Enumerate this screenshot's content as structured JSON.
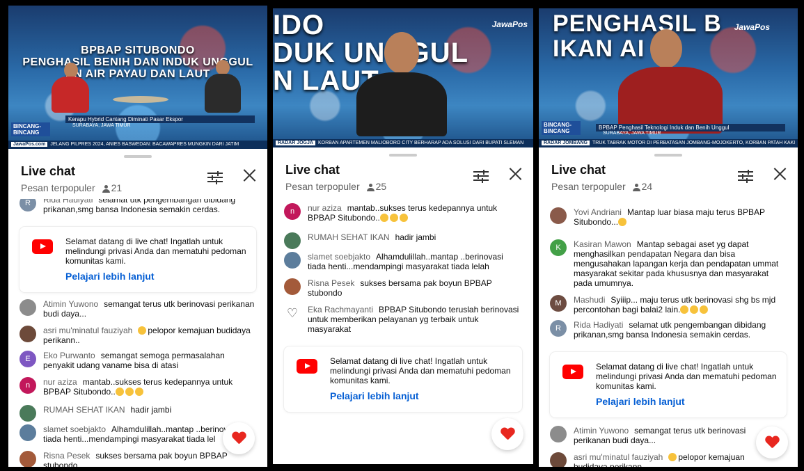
{
  "chat": {
    "title": "Live chat",
    "subtitle": "Pesan terpopuler",
    "welcome_text": "Selamat datang di live chat! Ingatlah untuk melindungi privasi Anda dan mematuhi pedoman komunitas kami.",
    "welcome_link": "Pelajari lebih lanjut"
  },
  "colors": {
    "link": "#065fd4",
    "youtube_red": "#ff0000",
    "heart": "#e8271f",
    "ticker": "#0d2f5b"
  },
  "icons": [
    "viewer-icon",
    "filter-icon",
    "close-icon",
    "youtube-icon",
    "heart-icon"
  ],
  "panels": [
    {
      "viewers": "21",
      "video": {
        "headline": "BPBAP SITUBONDO\nPENGHASIL BENIH DAN INDUK UNGGUL\nAN AIR PAYAU DAN LAUT",
        "ticker_top": "Kerapu Hybrid Cantang Diminati Pasar Ekspor",
        "location": "SURABAYA, JAWA TIMUR",
        "program": "BINCANG-BINCANG",
        "brand": "JawaPos.com",
        "ticker": "JELANG PILPRES 2024, ANIES BASWEDAN: BACAWAPRES MUNGKIN DARI JATIM"
      },
      "messages_before": [
        {
          "author": "Rida Hadiyati",
          "text": "selamat utk pengembangan dibidang prikanan,smg bansa Indonesia semakin cerdas.",
          "initial": "R",
          "color": "#7b8fa6"
        }
      ],
      "messages_after": [
        {
          "author": "Atimin Yuwono",
          "text": "semangat terus utk berinovasi perikanan budi daya...",
          "initial": "",
          "color": "#8c8c8c"
        },
        {
          "author": "asri mu'minatul fauziyah",
          "text": "pelopor kemajuan budidaya perikann..",
          "initial": "",
          "color": "#6d4a3a",
          "emoji": true
        },
        {
          "author": "Eko Purwanto",
          "text": "semangat semoga permasalahan penyakit udang vaname bisa di atasi",
          "initial": "E",
          "color": "#7e57c2"
        },
        {
          "author": "nur aziza",
          "text": "mantab..sukses terus kedepannya untuk BPBAP Situbondo..",
          "initial": "n",
          "color": "#c2185b",
          "emoji3": true
        },
        {
          "author": "RUMAH SEHAT IKAN",
          "text": "hadir jambi",
          "initial": "",
          "color": "#4a7a5a"
        },
        {
          "author": "slamet soebjakto",
          "text": "Alhamdulillah..mantap ..berinovasi tiada henti...mendampingi masyarakat tiada lel",
          "initial": "",
          "color": "#5c7d9c"
        },
        {
          "author": "Risna Pesek",
          "text": "sukses bersama pak boyun BPBAP stubondo",
          "initial": "",
          "color": "#a35a3a"
        }
      ]
    },
    {
      "viewers": "25",
      "video": {
        "big_headline": "IDO\nDUK UNGGUL\nN LAUT",
        "brand": "JawaPos",
        "ticker_tag": "RADAR JOGJA",
        "ticker": "KORBAN APARTEMEN MALIOBORO CITY BERHARAP ADA SOLUSI DARI BUPATI SLEMAN"
      },
      "messages": [
        {
          "author": "nur aziza",
          "text": "mantab..sukses terus kedepannya untuk BPBAP Situbondo..",
          "initial": "n",
          "color": "#c2185b",
          "emoji3": true
        },
        {
          "author": "RUMAH SEHAT IKAN",
          "text": "hadir jambi",
          "initial": "",
          "color": "#4a7a5a"
        },
        {
          "author": "slamet soebjakto",
          "text": "Alhamdulillah..mantap ..berinovasi tiada henti...mendampingi masyarakat tiada lelah",
          "initial": "",
          "color": "#5c7d9c"
        },
        {
          "author": "Risna Pesek",
          "text": "sukses bersama pak boyun BPBAP stubondo",
          "initial": "",
          "color": "#a35a3a"
        },
        {
          "author": "Eka Rachmayanti",
          "text": "BPBAP Situbondo teruslah berinovasi untuk memberikan pelayanan yg terbaik untuk masyarakat",
          "initial": "♡",
          "color": "#ffffff"
        }
      ]
    },
    {
      "viewers": "24",
      "video": {
        "big_headline": "PENGHASIL B\nIKAN AI",
        "brand": "JawaPos",
        "ticker_top": "BPBAP Penghasil Teknologi Induk dan Benih Unggul",
        "location": "SURABAYA, JAWA TIMUR",
        "program": "BINCANG-BINCANG",
        "ticker_tag": "RADAR JOMBANG",
        "ticker": "TRUK TABRAK MOTOR DI PERBATASAN JOMBANG-MOJOKERTO, KORBAN PATAH KAKI"
      },
      "messages_before": [
        {
          "author": "Yovi Andriani",
          "text": "Mantap luar biasa maju terus BPBAP Situbondo...",
          "initial": "",
          "color": "#8a5a4a",
          "emoji": true
        },
        {
          "author": "Kasiran Mawon",
          "text": "Mantap sebagai aset yg dapat menghasilkan pendapatan Negara dan bisa mengusahakan lapangan kerja dan pendapatan ummat masyarakat sekitar pada khususnya dan masyarakat pada umumnya.",
          "initial": "K",
          "color": "#43a047"
        },
        {
          "author": "Mashudi",
          "text": "Syiiip... maju terus utk berinovasi shg bs mjd percontohan bagi balai2 lain.",
          "initial": "M",
          "color": "#6d4c41",
          "emoji3": true
        },
        {
          "author": "Rida Hadiyati",
          "text": "selamat utk pengembangan dibidang prikanan,smg bansa Indonesia semakin cerdas.",
          "initial": "R",
          "color": "#7b8fa6"
        }
      ],
      "messages_after": [
        {
          "author": "Atimin Yuwono",
          "text": "semangat terus utk berinovasi perikanan budi daya...",
          "initial": "",
          "color": "#8c8c8c"
        },
        {
          "author": "asri mu'minatul fauziyah",
          "text": "pelopor kemajuan budidaya perikann..",
          "initial": "",
          "color": "#6d4a3a",
          "emoji": true
        }
      ]
    }
  ]
}
